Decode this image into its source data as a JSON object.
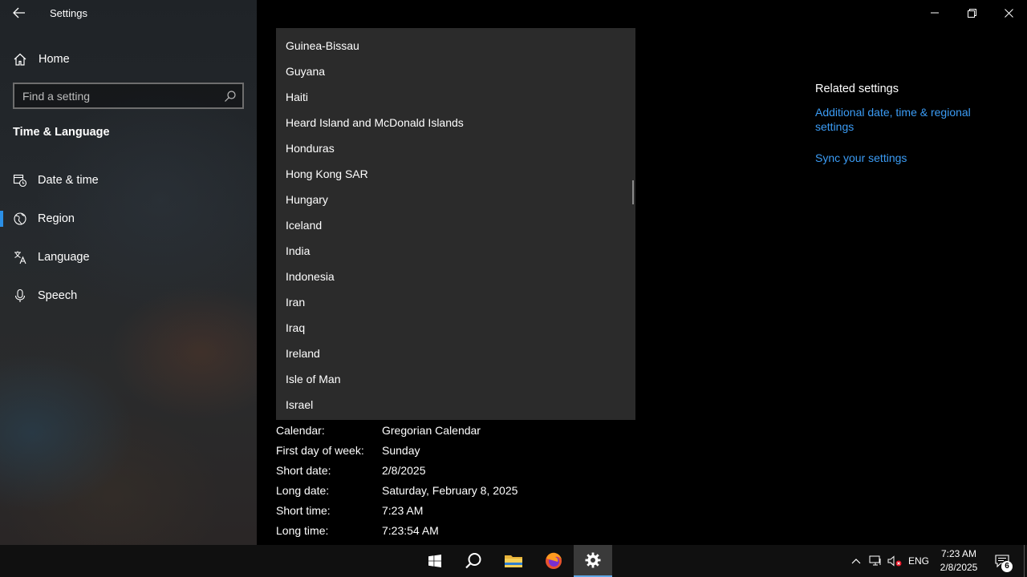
{
  "window": {
    "title": "Settings",
    "controls": [
      "minimize",
      "restore",
      "close"
    ]
  },
  "sidebar": {
    "home_label": "Home",
    "search_placeholder": "Find a setting",
    "section_title": "Time & Language",
    "items": [
      {
        "label": "Date & time",
        "icon": "clock-calendar-icon",
        "active": false
      },
      {
        "label": "Region",
        "icon": "globe-icon",
        "active": true
      },
      {
        "label": "Language",
        "icon": "language-icon",
        "active": false
      },
      {
        "label": "Speech",
        "icon": "microphone-icon",
        "active": false
      }
    ]
  },
  "region_dropdown": {
    "options": [
      "Guinea-Bissau",
      "Guyana",
      "Haiti",
      "Heard Island and McDonald Islands",
      "Honduras",
      "Hong Kong SAR",
      "Hungary",
      "Iceland",
      "India",
      "Indonesia",
      "Iran",
      "Iraq",
      "Ireland",
      "Isle of Man",
      "Israel"
    ]
  },
  "regional_format_data": [
    {
      "key": "Calendar:",
      "value": "Gregorian Calendar"
    },
    {
      "key": "First day of week:",
      "value": "Sunday"
    },
    {
      "key": "Short date:",
      "value": "2/8/2025"
    },
    {
      "key": "Long date:",
      "value": "Saturday, February 8, 2025"
    },
    {
      "key": "Short time:",
      "value": "7:23 AM"
    },
    {
      "key": "Long time:",
      "value": "7:23:54 AM"
    }
  ],
  "related_settings": {
    "title": "Related settings",
    "links": [
      "Additional date, time & regional settings",
      "Sync your settings"
    ]
  },
  "taskbar": {
    "apps": [
      "windows-start-icon",
      "search-icon",
      "file-explorer-icon",
      "firefox-icon",
      "settings-gear-icon"
    ],
    "language": "ENG",
    "time": "7:23 AM",
    "date": "2/8/2025",
    "notification_count": "6"
  },
  "colors": {
    "accent": "#2b8fe6",
    "link": "#3b9cf5",
    "dropdown_bg": "#2b2b2b"
  }
}
